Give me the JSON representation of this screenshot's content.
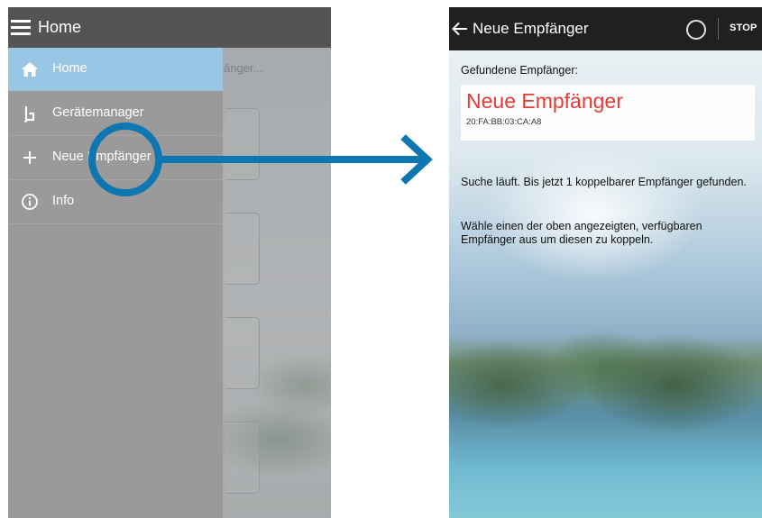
{
  "left_phone": {
    "appbar_title": "Home",
    "background_hint": "änger...",
    "drawer": {
      "items": [
        {
          "label": "Home",
          "icon": "home-icon",
          "active": true
        },
        {
          "label": "Gerätemanager",
          "icon": "device-manager-icon",
          "active": false
        },
        {
          "label": "Neue Empfänger",
          "icon": "plus-icon",
          "active": false
        },
        {
          "label": "Info",
          "icon": "info-icon",
          "active": false
        }
      ]
    }
  },
  "right_phone": {
    "appbar": {
      "title": "Neue Empfänger",
      "stop_label": "STOP",
      "spinner_icon": "spinner-icon"
    },
    "found_label": "Gefundene Empfänger:",
    "device": {
      "name": "Neue Empfänger",
      "mac": "20:FA:BB:03:CA:A8"
    },
    "status_message": "Suche läuft. Bis jetzt 1 koppelbarer Empfänger gefunden.",
    "instruction_message": "Wähle einen der oben angezeigten, verfügbaren Empfänger aus um diesen zu koppeln."
  },
  "colors": {
    "accent_blue": "#0e77b1",
    "device_name_red": "#e53935",
    "drawer_active": "#9ac6e6",
    "appbar_dark": "#202020"
  }
}
